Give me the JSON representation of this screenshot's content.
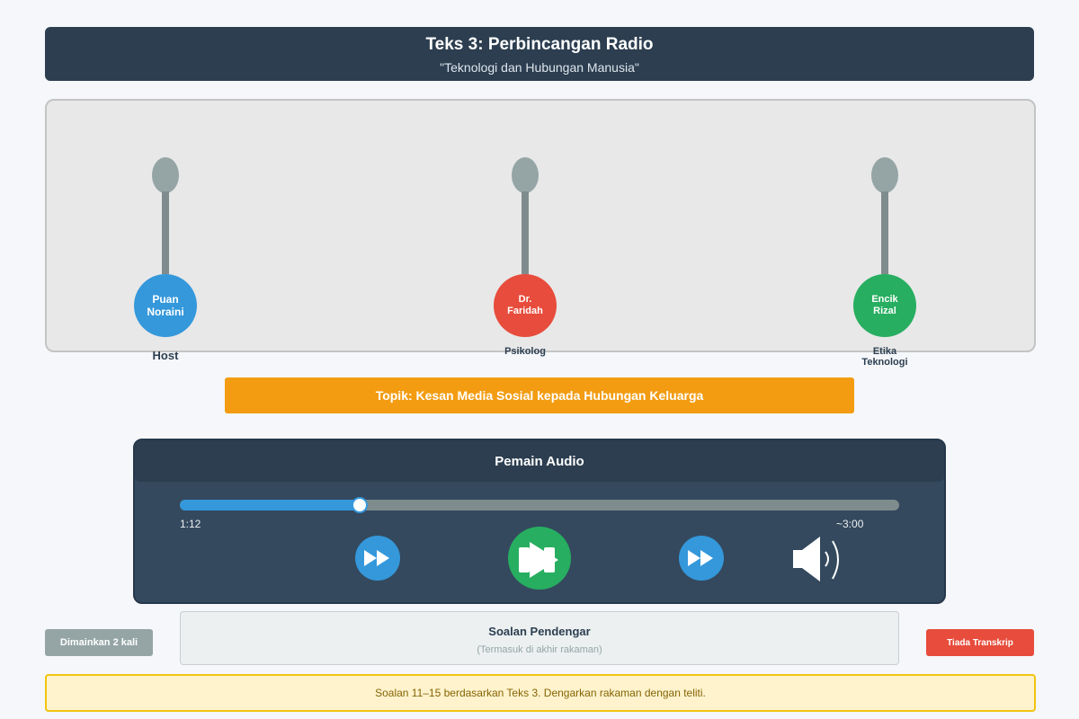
{
  "header": {
    "title": "Teks 3: Perbincangan Radio",
    "subtitle": "\"Teknologi dan Hubungan Manusia\""
  },
  "speakers": [
    {
      "name": "Puan Noraini",
      "role": "Host",
      "color": "#3498db"
    },
    {
      "name": "Dr. Faridah",
      "role": "Psikolog",
      "color": "#e74c3c"
    },
    {
      "name": "Encik Rizal",
      "role": "Etika Teknologi",
      "color": "#27ae60"
    }
  ],
  "topic": "Topik: Kesan Media Sosial kepada Hubungan Keluarga",
  "player": {
    "title": "Pemain Audio",
    "progress": 0.25,
    "current_time": "1:12",
    "total_time": "~3:00",
    "icons": [
      "rewind-icon",
      "play-icon",
      "fast-forward-icon",
      "volume-icon"
    ]
  },
  "footer": {
    "played_badge": "Dimainkan 2 kali",
    "questions_title": "Soalan Pendengar",
    "questions_subtitle": "(Termasuk di akhir rakaman)",
    "transcript_badge": "Tiada Transkrip",
    "note": "Soalan 11–15 berdasarkan Teks 3. Dengarkan rakaman dengan teliti."
  },
  "colors": {
    "header_bg": "#2c3e50",
    "topic_bg": "#f39c12",
    "accent_blue": "#3498db",
    "play_green": "#27ae60",
    "alert_red": "#e74c3c"
  }
}
